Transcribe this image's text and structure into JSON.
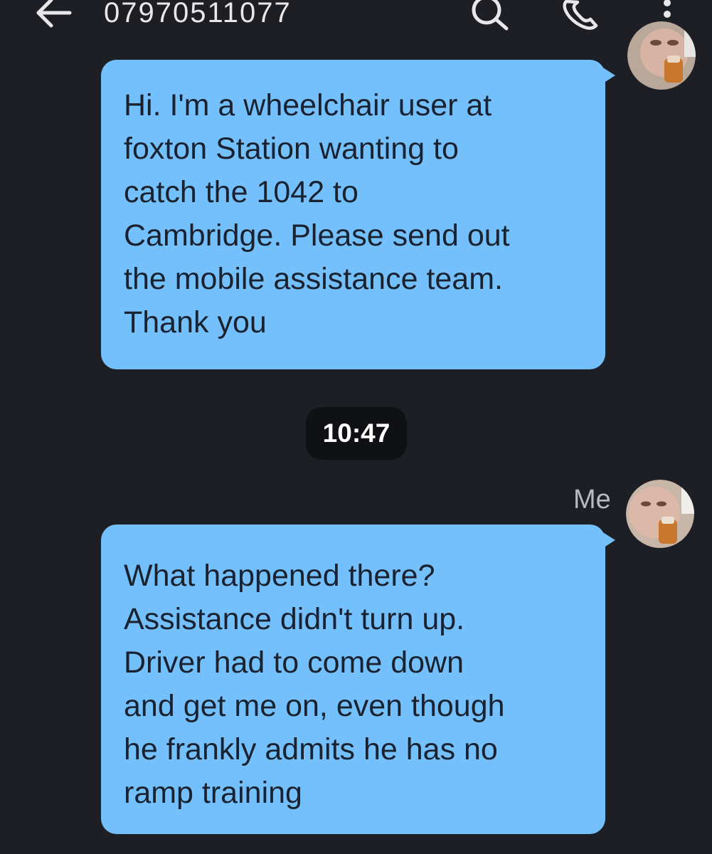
{
  "header": {
    "contact": "07970511077",
    "back_icon": "arrow-left-icon",
    "search_icon": "search-icon",
    "call_icon": "phone-icon",
    "more_icon": "more-vertical-icon"
  },
  "messages": [
    {
      "lines": [
        "Hi. I'm a wheelchair user at",
        "foxton Station wanting to",
        "catch the 1042 to",
        "Cambridge. Please send out",
        "the mobile assistance team.",
        "Thank you"
      ]
    },
    {
      "sender": "Me",
      "lines": [
        "What happened there?",
        "Assistance didn't turn up.",
        "Driver had to come down",
        "and get me on, even though",
        "he frankly admits he has no",
        "ramp training"
      ]
    }
  ],
  "divider": {
    "time": "10:47"
  },
  "colors": {
    "background": "#1e1f24",
    "bubble": "#74c0fc",
    "bubble_text": "#1a2230",
    "header_text": "#e8e8ea",
    "timestamp_bg": "#101114"
  }
}
